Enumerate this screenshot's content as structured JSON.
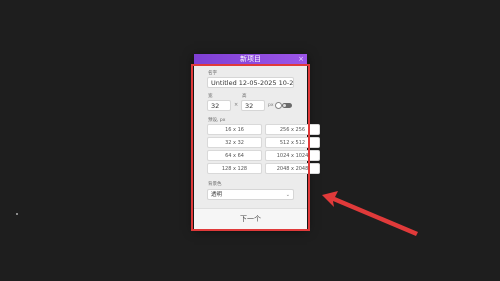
{
  "dialog": {
    "title": "新项目",
    "close_label": "×",
    "name_label": "名字",
    "name_value": "Untitled 12-05-2025 10-22-",
    "width_label": "宽",
    "height_label": "高",
    "width_value": "32",
    "height_value": "32",
    "times_sign": "×",
    "unit": "px",
    "presets_label": "预设, px",
    "presets": [
      "16 x 16",
      "256 x 256",
      "32 x 32",
      "512 x 512",
      "64 x 64",
      "1024 x 1024",
      "128 x 128",
      "2048 x 2048"
    ],
    "bg_label": "背景色",
    "bg_value": "透明",
    "next_label": "下一个"
  },
  "colors": {
    "titlebar": "#8c4be0",
    "highlight": "#e03a3a",
    "background": "#1e1e1e"
  }
}
